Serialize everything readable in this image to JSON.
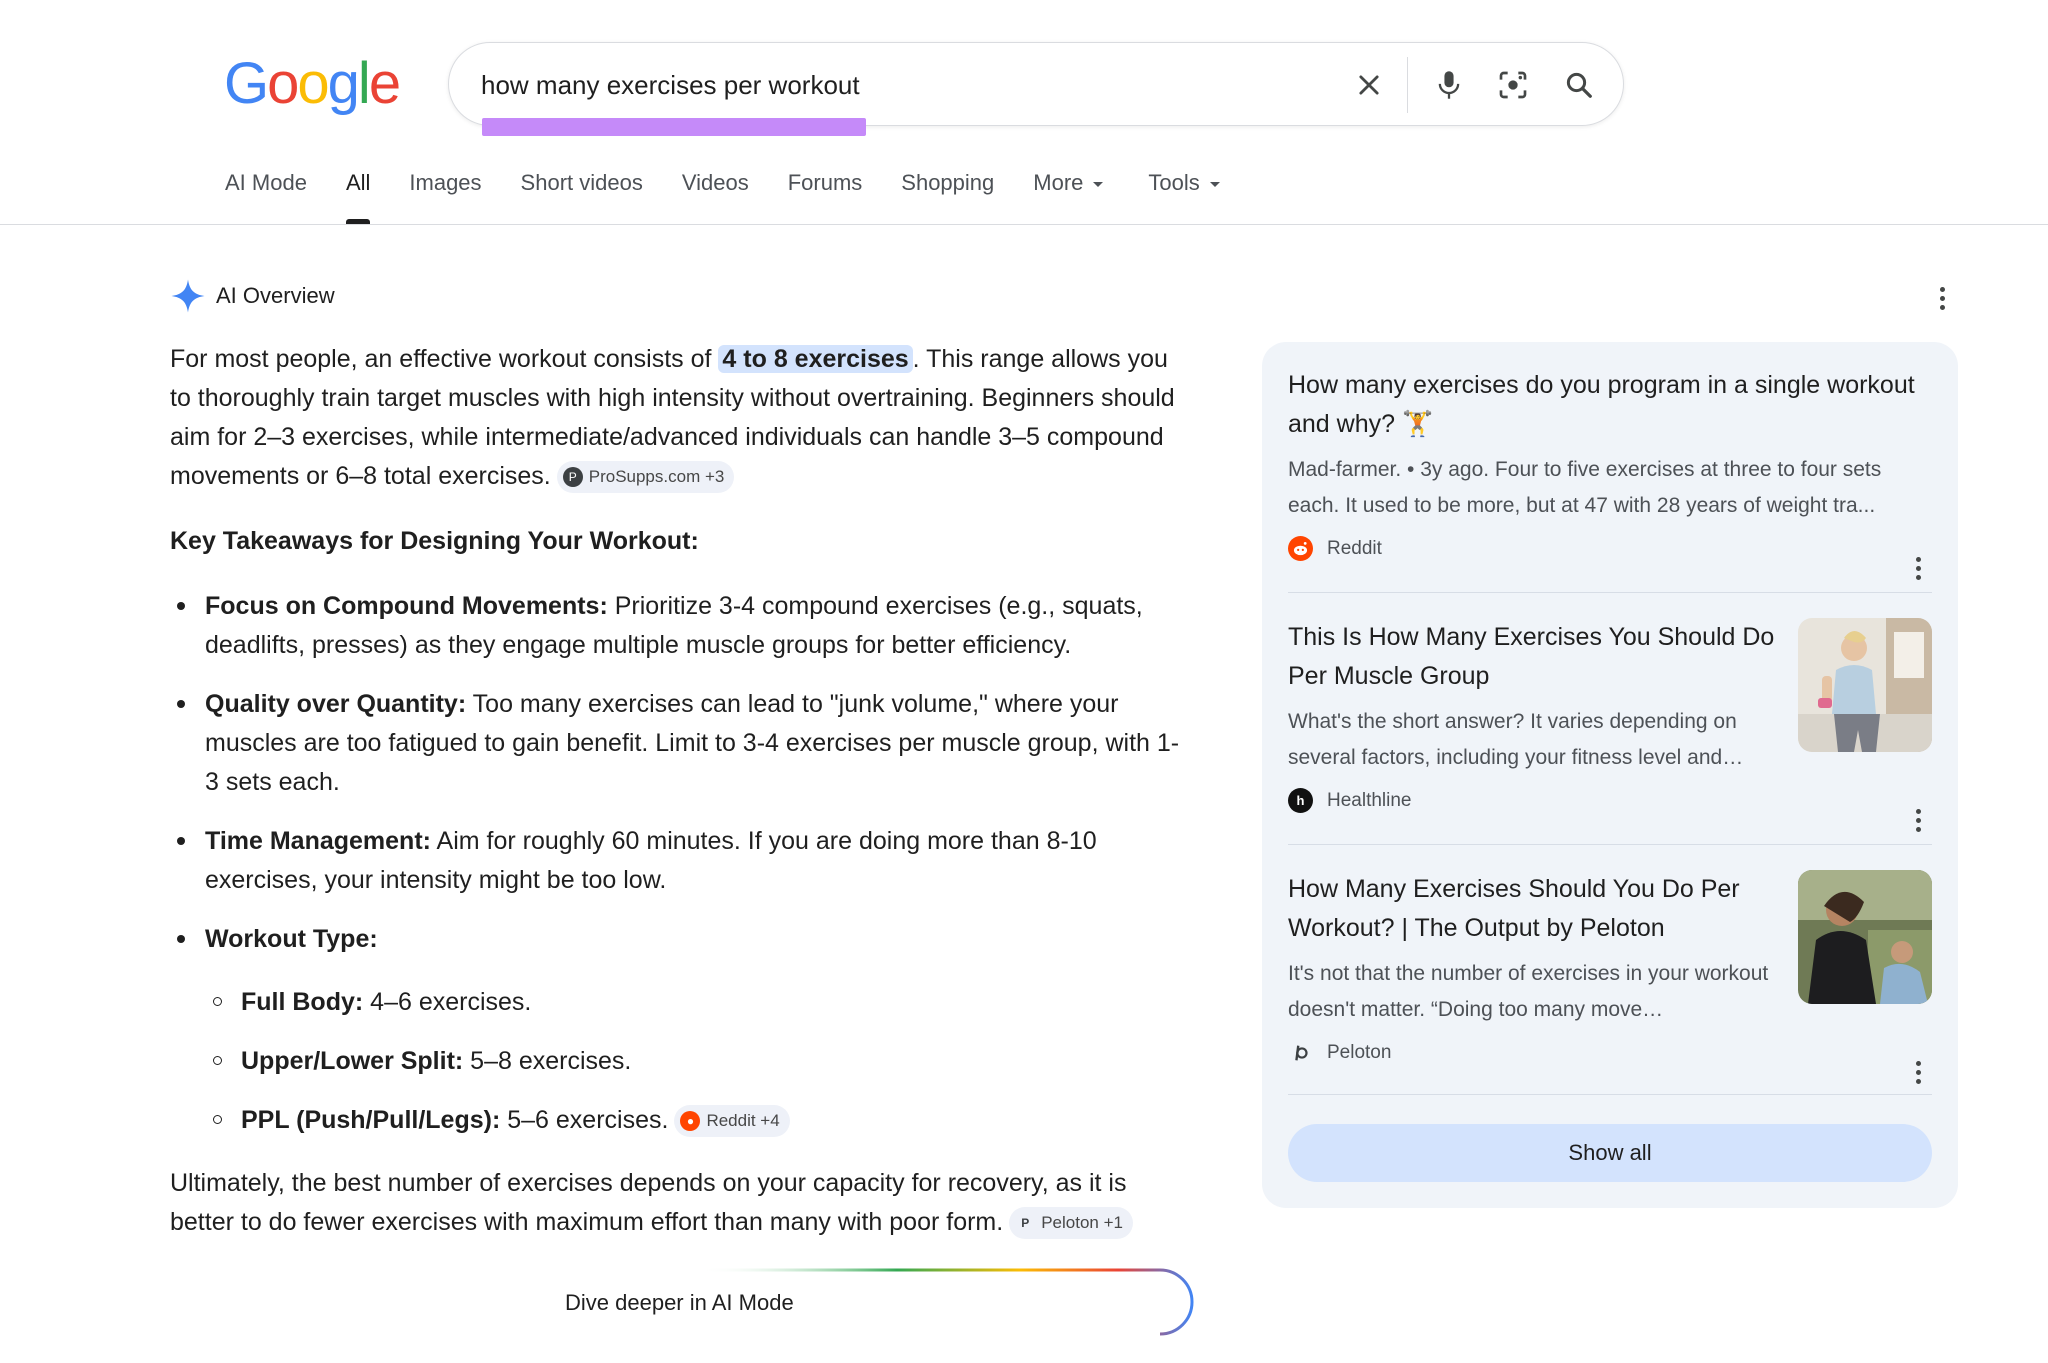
{
  "logo": {
    "letters": [
      "G",
      "o",
      "o",
      "g",
      "l",
      "e"
    ]
  },
  "search": {
    "query": "how many exercises per workout"
  },
  "tabs": {
    "ai_mode": "AI Mode",
    "all": "All",
    "images": "Images",
    "short_videos": "Short videos",
    "videos": "Videos",
    "forums": "Forums",
    "shopping": "Shopping",
    "more": "More",
    "tools": "Tools"
  },
  "ai_overview": {
    "label": "AI Overview",
    "intro_before": "For most people, an effective workout consists of ",
    "intro_highlight": "4 to 8 exercises",
    "intro_after": ". This range allows you to thoroughly train target muscles with high intensity without overtraining. Beginners should aim for 2–3 exercises, while intermediate/advanced individuals can handle 3–5 compound movements or 6–8 total exercises.",
    "intro_chip": "ProSupps.com +3",
    "takeaways_title": "Key Takeaways for Designing Your Workout:",
    "bullets": [
      {
        "title": "Focus on Compound Movements:",
        "text": " Prioritize 3-4 compound exercises (e.g., squats, deadlifts, presses) as they engage multiple muscle groups for better efficiency."
      },
      {
        "title": "Quality over Quantity:",
        "text": " Too many exercises can lead to \"junk volume,\" where your muscles are too fatigued to gain benefit. Limit to 3-4 exercises per muscle group, with 1-3 sets each."
      },
      {
        "title": "Time Management:",
        "text": " Aim for roughly 60 minutes. If you are doing more than 8-10 exercises, your intensity might be too low."
      },
      {
        "title": "Workout Type:",
        "text": ""
      }
    ],
    "sub_bullets": [
      {
        "title": "Full Body:",
        "text": " 4–6 exercises."
      },
      {
        "title": "Upper/Lower Split:",
        "text": " 5–8 exercises."
      },
      {
        "title": "PPL (Push/Pull/Legs):",
        "text": " 5–6 exercises."
      }
    ],
    "sub_chip": "Reddit +4",
    "closing": "Ultimately, the best number of exercises depends on your capacity for recovery, as it is better to do fewer exercises with maximum effort than many with poor form.",
    "closing_chip": "Peloton +1",
    "dive_deeper": "Dive deeper in AI Mode"
  },
  "sources": [
    {
      "title": "How many exercises do you program in a single workout and why? 🏋️",
      "snippet": "Mad-farmer. • 3y ago. Four to five exercises at three to four sets each. It used to be more, but at 47 with 28 years of weight tra...",
      "site": "Reddit"
    },
    {
      "title": "This Is How Many Exercises You Should Do Per Muscle Group",
      "snippet": "What's the short answer? It varies depending on several factors, including your fitness level and…",
      "site": "Healthline"
    },
    {
      "title": "How Many Exercises Should You Do Per Workout? | The Output by Peloton",
      "snippet": "It's not that the number of exercises in your workout doesn't matter. “Doing too many move…",
      "site": "Peloton"
    }
  ],
  "show_all": "Show all",
  "colors": {
    "accent_blue": "#4285f4",
    "reddit": "#ff4500",
    "highlight": "#d3e3fd",
    "query_marker": "#c58af9"
  }
}
